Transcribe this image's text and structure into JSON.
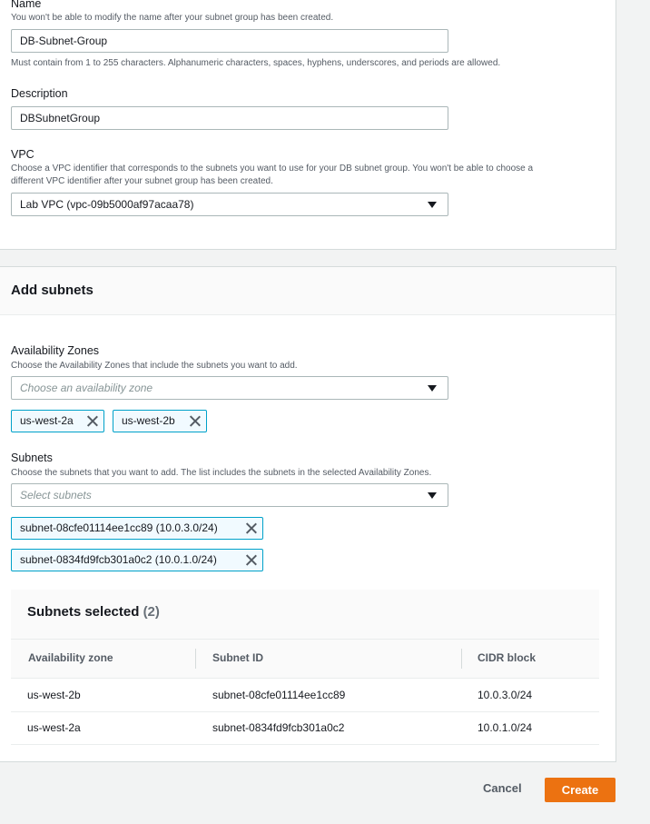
{
  "name_field": {
    "label": "Name",
    "hint": "You won't be able to modify the name after your subnet group has been created.",
    "value": "DB-Subnet-Group",
    "constraint": "Must contain from 1 to 255 characters. Alphanumeric characters, spaces, hyphens, underscores, and periods are allowed."
  },
  "description_field": {
    "label": "Description",
    "value": "DBSubnetGroup"
  },
  "vpc_field": {
    "label": "VPC",
    "hint_line1": "Choose a VPC identifier that corresponds to the subnets you want to use for your DB subnet group. You won't be able to choose a",
    "hint_line2": "different VPC identifier after your subnet group has been created.",
    "value": "Lab VPC (vpc-09b5000af97acaa78)"
  },
  "add_subnets": {
    "title": "Add subnets",
    "az_label": "Availability Zones",
    "az_hint": "Choose the Availability Zones that include the subnets you want to add.",
    "az_placeholder": "Choose an availability zone",
    "az_tokens": [
      "us-west-2a",
      "us-west-2b"
    ],
    "subnets_label": "Subnets",
    "subnets_hint": "Choose the subnets that you want to add. The list includes the subnets in the selected Availability Zones.",
    "subnets_placeholder": "Select subnets",
    "subnet_tokens": [
      "subnet-08cfe01114ee1cc89 (10.0.3.0/24)",
      "subnet-0834fd9fcb301a0c2 (10.0.1.0/24)"
    ]
  },
  "selected_table": {
    "title": "Subnets selected",
    "count": "(2)",
    "columns": [
      "Availability zone",
      "Subnet ID",
      "CIDR block"
    ],
    "rows": [
      [
        "us-west-2b",
        "subnet-08cfe01114ee1cc89",
        "10.0.3.0/24"
      ],
      [
        "us-west-2a",
        "subnet-0834fd9fcb301a0c2",
        "10.0.1.0/24"
      ]
    ]
  },
  "actions": {
    "cancel": "Cancel",
    "create": "Create"
  },
  "colors": {
    "accent_orange": "#ec7211",
    "token_border": "#00a1c9"
  }
}
